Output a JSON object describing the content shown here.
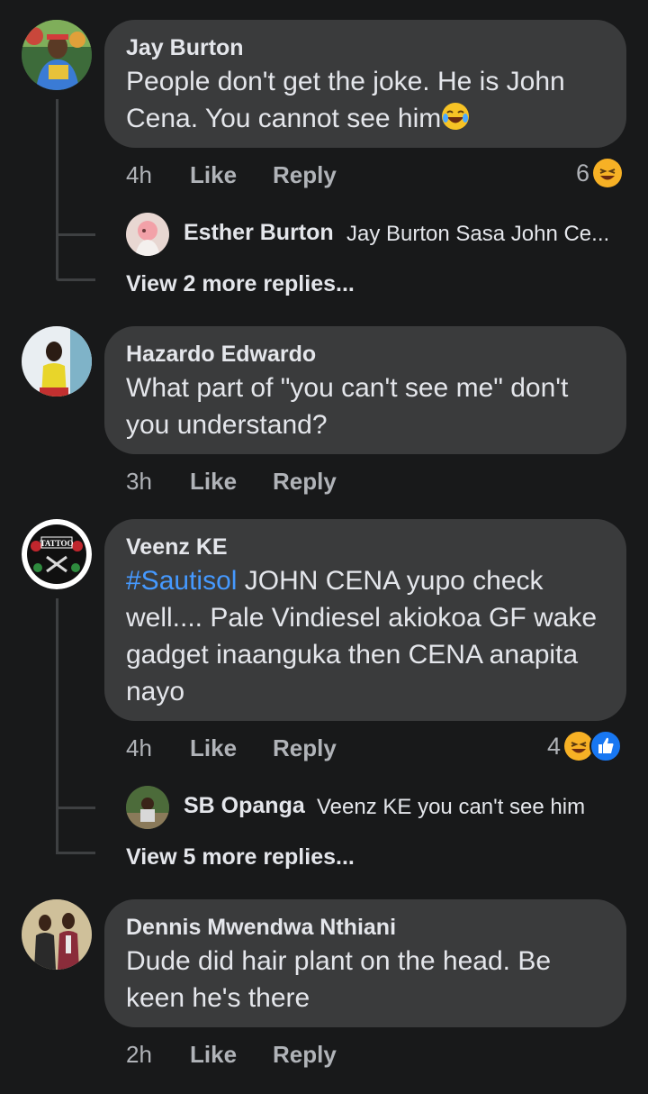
{
  "comments": [
    {
      "author": "Jay Burton",
      "text": "People don't get the joke. He is John Cena. You cannot see him",
      "time": "4h",
      "like": "Like",
      "reply": "Reply",
      "reaction_count": "6",
      "reactions": [
        "laugh-emoji"
      ],
      "reply_preview": {
        "author": "Esther Burton",
        "text": "Jay Burton Sasa John Ce..."
      },
      "view_more": "View 2 more replies..."
    },
    {
      "author": "Hazardo Edwardo",
      "text": "What part of \"you can't see me\" don't you understand?",
      "time": "3h",
      "like": "Like",
      "reply": "Reply"
    },
    {
      "author": "Veenz KE",
      "hashtag": "#Sautisol",
      "text": " JOHN CENA yupo check well.... Pale Vindiesel akiokoa GF wake gadget inaanguka then CENA anapita nayo",
      "time": "4h",
      "like": "Like",
      "reply": "Reply",
      "reaction_count": "4",
      "reactions": [
        "laugh-emoji",
        "like-emoji"
      ],
      "reply_preview": {
        "author": "SB Opanga",
        "text": "Veenz KE you can't see him"
      },
      "view_more": "View 5 more replies..."
    },
    {
      "author": "Dennis Mwendwa Nthiani",
      "text": "Dude did hair plant on the head. Be keen he's there",
      "time": "2h",
      "like": "Like",
      "reply": "Reply"
    }
  ],
  "avatar_logo_text": "TATTOO",
  "colors": {
    "background": "#18191a",
    "bubble": "#3a3b3c",
    "text": "#e4e6eb",
    "muted": "#b0b3b8",
    "hashtag": "#4599ff",
    "like_blue": "#1877f2",
    "laugh_yellow": "#f7b125"
  }
}
